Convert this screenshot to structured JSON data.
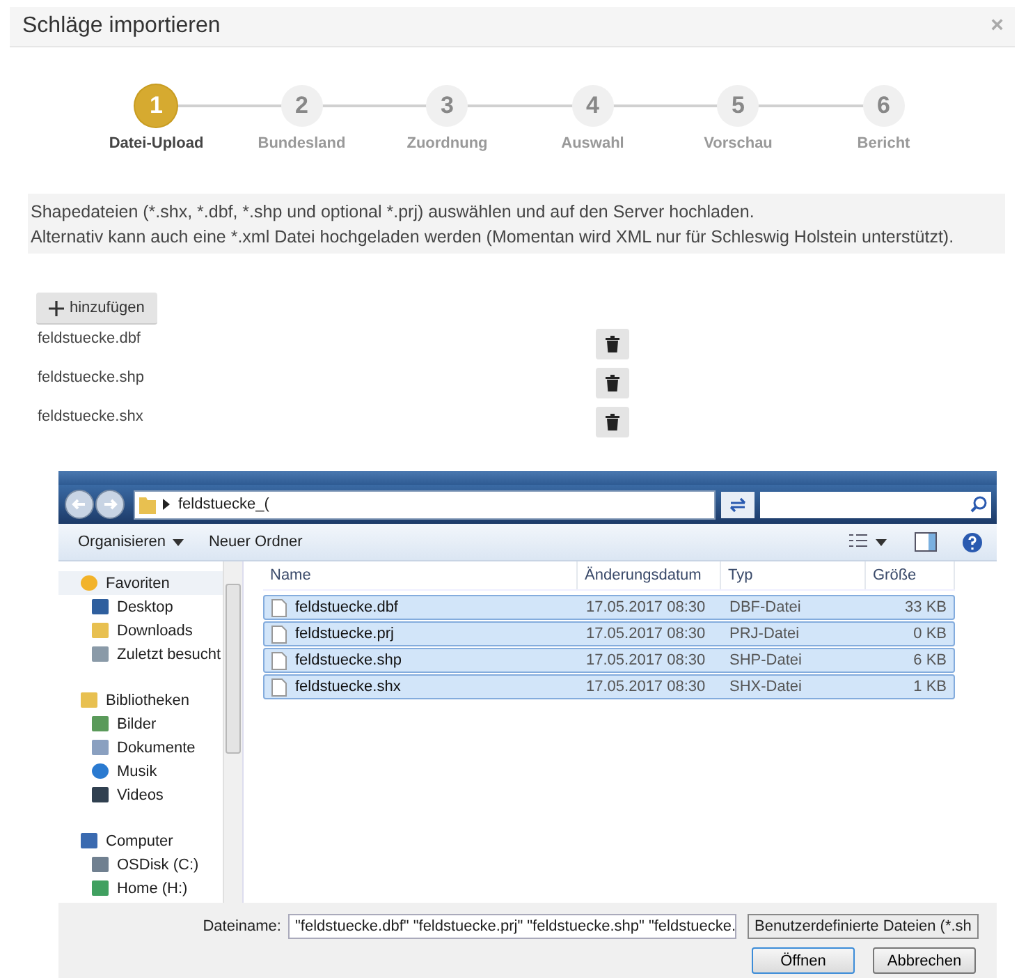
{
  "modal": {
    "title": "Schläge importieren",
    "close": "×"
  },
  "steps": [
    {
      "number": "1",
      "label": "Datei-Upload",
      "selected": true
    },
    {
      "number": "2",
      "label": "Bundesland",
      "selected": false
    },
    {
      "number": "3",
      "label": "Zuordnung",
      "selected": false
    },
    {
      "number": "4",
      "label": "Auswahl",
      "selected": false
    },
    {
      "number": "5",
      "label": "Vorschau",
      "selected": false
    },
    {
      "number": "6",
      "label": "Bericht",
      "selected": false
    }
  ],
  "description": [
    "Shapedateien (*.shx, *.dbf, *.shp und optional *.prj) auswählen und auf den Server hochladen.",
    "Alternativ kann auch eine *.xml Datei hochgeladen werden (Momentan wird XML nur für Schleswig Holstein unterstützt)."
  ],
  "add_button": {
    "label": "hinzufügen"
  },
  "files": [
    "feldstuecke.dbf",
    "feldstuecke.shp",
    "feldstuecke.shx"
  ],
  "file_dialog": {
    "address": "feldstuecke_(",
    "toolbar": [
      {
        "label": "Organisieren",
        "dropdown": true
      },
      {
        "label": "Neuer Ordner",
        "dropdown": false
      }
    ],
    "sidebar": [
      {
        "label": "Favoriten",
        "kind": "star",
        "selected": true,
        "children": [
          {
            "label": "Desktop",
            "kind": "desktop",
            "selected": false
          },
          {
            "label": "Downloads",
            "kind": "folder",
            "selected": false
          },
          {
            "label": "Zuletzt besucht",
            "kind": "recent",
            "selected": false
          }
        ]
      },
      {
        "label": "Bibliotheken",
        "kind": "folder",
        "selected": false,
        "children": [
          {
            "label": "Bilder",
            "kind": "image",
            "selected": false
          },
          {
            "label": "Dokumente",
            "kind": "document",
            "selected": false
          },
          {
            "label": "Musik",
            "kind": "music",
            "selected": false
          },
          {
            "label": "Videos",
            "kind": "video",
            "selected": false
          }
        ]
      },
      {
        "label": "Computer",
        "kind": "computer",
        "selected": false,
        "children": [
          {
            "label": "OSDisk (C:)",
            "kind": "disk",
            "selected": false
          },
          {
            "label": "Home (H:)",
            "kind": "network",
            "selected": false
          }
        ]
      }
    ],
    "columns": [
      "Name",
      "Änderungsdatum",
      "Typ",
      "Größe"
    ],
    "rows": [
      {
        "name": "feldstuecke.dbf",
        "date": "17.05.2017 08:30",
        "type": "DBF-Datei",
        "size": "33 KB",
        "selected": true
      },
      {
        "name": "feldstuecke.prj",
        "date": "17.05.2017 08:30",
        "type": "PRJ-Datei",
        "size": "0 KB",
        "selected": true
      },
      {
        "name": "feldstuecke.shp",
        "date": "17.05.2017 08:30",
        "type": "SHP-Datei",
        "size": "6 KB",
        "selected": true
      },
      {
        "name": "feldstuecke.shx",
        "date": "17.05.2017 08:30",
        "type": "SHX-Datei",
        "size": "1 KB",
        "selected": true
      }
    ],
    "filename_label": "Dateiname:",
    "filename": "\"feldstuecke.dbf\" \"feldstuecke.prj\" \"feldstuecke.shp\" \"feldstuecke.",
    "filetype": "Benutzerdefinierte Dateien (*.sh",
    "buttons": [
      "Öffnen",
      "Abbrechen"
    ]
  }
}
